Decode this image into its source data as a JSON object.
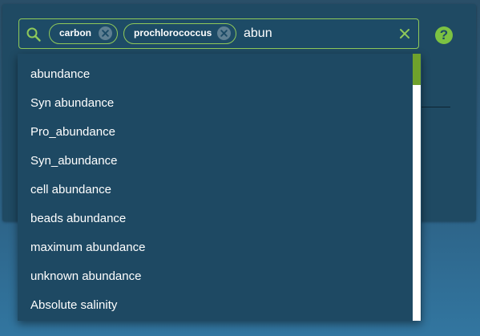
{
  "search": {
    "query": "abun",
    "icon": "search-icon",
    "accent_color": "#8fc95a"
  },
  "chips": [
    {
      "label": "carbon",
      "remove_icon": "close-icon"
    },
    {
      "label": "prochlorococcus",
      "remove_icon": "close-icon"
    }
  ],
  "help": {
    "icon": "help-icon",
    "label": "?",
    "color": "#7cc242"
  },
  "suggestions": [
    "abundance",
    "Syn abundance",
    "Pro_abundance",
    "Syn_abundance",
    "cell abundance",
    "beads abundance",
    "maximum abundance",
    "unknown abundance",
    "Absolute salinity"
  ],
  "scroll": {
    "position_fraction": 0
  }
}
